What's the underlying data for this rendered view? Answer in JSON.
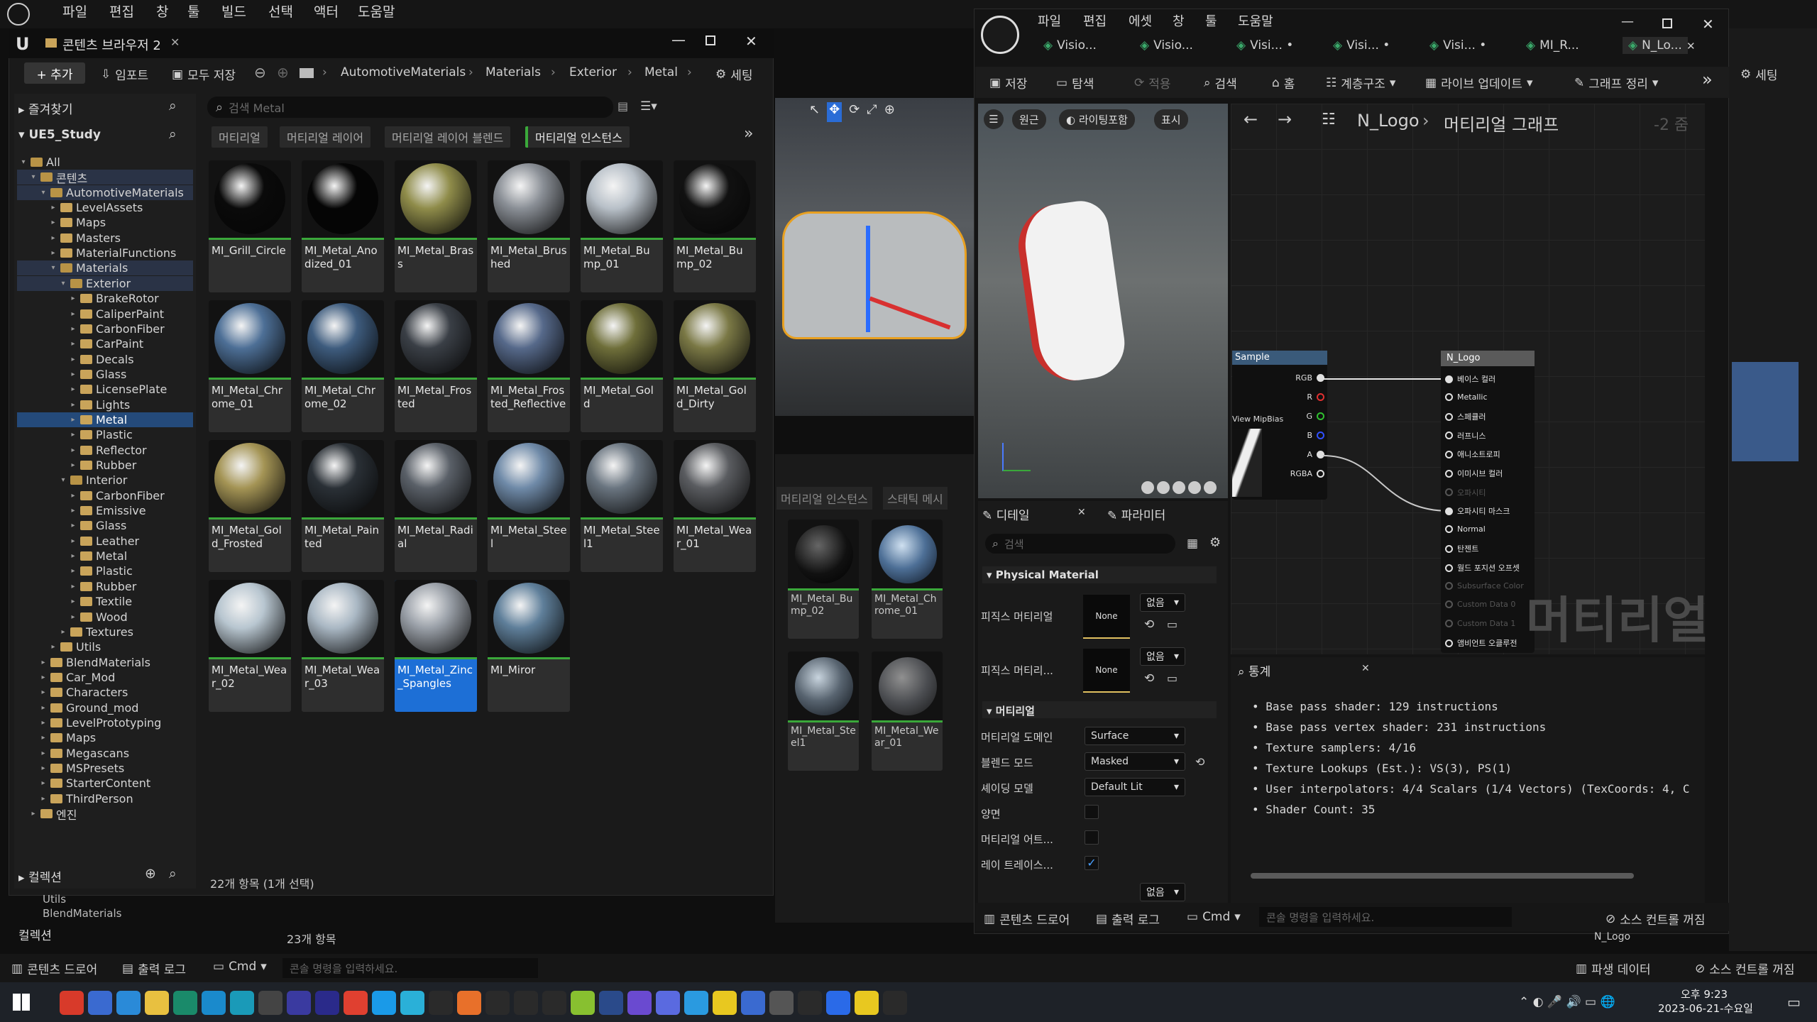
{
  "main_menu": {
    "items": [
      "파일",
      "편집",
      "창",
      "툴",
      "빌드",
      "선택",
      "액터",
      "도움말"
    ]
  },
  "content_browser": {
    "title": "콘텐츠 브라우저 2",
    "add_label": "+ 추가",
    "import_label": "임포트",
    "save_all_label": "모두 저장",
    "breadcrumb": [
      "AutomotiveMaterials",
      "Materials",
      "Exterior",
      "Metal"
    ],
    "settings_label": "세팅",
    "favorites_label": "즐겨찾기",
    "project_label": "UE5_Study",
    "search_placeholder": "검색 Metal",
    "filters": [
      "머티리얼",
      "머티리얼 레이어",
      "머티리얼 레이어 블렌드",
      "머티리얼 인스턴스"
    ],
    "tree": [
      {
        "label": "All",
        "indent": 0,
        "open": true
      },
      {
        "label": "콘텐츠",
        "indent": 1,
        "open": true
      },
      {
        "label": "AutomotiveMaterials",
        "indent": 2,
        "open": true
      },
      {
        "label": "LevelAssets",
        "indent": 3
      },
      {
        "label": "Maps",
        "indent": 3
      },
      {
        "label": "Masters",
        "indent": 3
      },
      {
        "label": "MaterialFunctions",
        "indent": 3
      },
      {
        "label": "Materials",
        "indent": 3,
        "open": true
      },
      {
        "label": "Exterior",
        "indent": 4,
        "open": true
      },
      {
        "label": "BrakeRotor",
        "indent": 5
      },
      {
        "label": "CaliperPaint",
        "indent": 5
      },
      {
        "label": "CarbonFiber",
        "indent": 5
      },
      {
        "label": "CarPaint",
        "indent": 5
      },
      {
        "label": "Decals",
        "indent": 5
      },
      {
        "label": "Glass",
        "indent": 5
      },
      {
        "label": "LicensePlate",
        "indent": 5
      },
      {
        "label": "Lights",
        "indent": 5
      },
      {
        "label": "Metal",
        "indent": 5,
        "selected": true
      },
      {
        "label": "Plastic",
        "indent": 5
      },
      {
        "label": "Reflector",
        "indent": 5
      },
      {
        "label": "Rubber",
        "indent": 5
      },
      {
        "label": "Interior",
        "indent": 4,
        "open": true
      },
      {
        "label": "CarbonFiber",
        "indent": 5
      },
      {
        "label": "Emissive",
        "indent": 5
      },
      {
        "label": "Glass",
        "indent": 5
      },
      {
        "label": "Leather",
        "indent": 5
      },
      {
        "label": "Metal",
        "indent": 5
      },
      {
        "label": "Plastic",
        "indent": 5
      },
      {
        "label": "Rubber",
        "indent": 5
      },
      {
        "label": "Textile",
        "indent": 5
      },
      {
        "label": "Wood",
        "indent": 5
      },
      {
        "label": "Textures",
        "indent": 4
      },
      {
        "label": "Utils",
        "indent": 3
      },
      {
        "label": "BlendMaterials",
        "indent": 2
      },
      {
        "label": "Car_Mod",
        "indent": 2
      },
      {
        "label": "Characters",
        "indent": 2
      },
      {
        "label": "Ground_mod",
        "indent": 2
      },
      {
        "label": "LevelPrototyping",
        "indent": 2
      },
      {
        "label": "Maps",
        "indent": 2
      },
      {
        "label": "Megascans",
        "indent": 2
      },
      {
        "label": "MSPresets",
        "indent": 2
      },
      {
        "label": "StarterContent",
        "indent": 2
      },
      {
        "label": "ThirdPerson",
        "indent": 2
      },
      {
        "label": "엔진",
        "indent": 1
      }
    ],
    "collections_label": "컬렉션",
    "assets": [
      {
        "name": "MI_Grill_Circle",
        "color": "#0a0a0a"
      },
      {
        "name": "MI_Metal_Anodized_01",
        "color": "#050505"
      },
      {
        "name": "MI_Metal_Brass",
        "color": "#8f8c4a"
      },
      {
        "name": "MI_Metal_Brushed",
        "color": "#8a8f96"
      },
      {
        "name": "MI_Metal_Bump_01",
        "color": "#b8c0c8"
      },
      {
        "name": "MI_Metal_Bump_02",
        "color": "#111111"
      },
      {
        "name": "MI_Metal_Chrome_01",
        "color": "#4d6f96"
      },
      {
        "name": "MI_Metal_Chrome_02",
        "color": "#3e5c7e"
      },
      {
        "name": "MI_Metal_Frosted",
        "color": "#3a3f46"
      },
      {
        "name": "MI_Metal_Frosted_Reflective",
        "color": "#56698a"
      },
      {
        "name": "MI_Metal_Gold",
        "color": "#6f6f3a"
      },
      {
        "name": "MI_Metal_Gold_Dirty",
        "color": "#7a7845"
      },
      {
        "name": "MI_Metal_Gold_Frosted",
        "color": "#a49455"
      },
      {
        "name": "MI_Metal_Painted",
        "color": "#2a3036"
      },
      {
        "name": "MI_Metal_Radial",
        "color": "#5a6068"
      },
      {
        "name": "MI_Metal_Steel",
        "color": "#6f8aa8"
      },
      {
        "name": "MI_Metal_Steel1",
        "color": "#6a7580"
      },
      {
        "name": "MI_Metal_Wear_01",
        "color": "#5a5c60"
      },
      {
        "name": "MI_Metal_Wear_02",
        "color": "#b8c6d0"
      },
      {
        "name": "MI_Metal_Wear_03",
        "color": "#aab8c4"
      },
      {
        "name": "MI_Metal_Zinc_Spangles",
        "color": "#9aa0a8",
        "selected": true
      },
      {
        "name": "MI_Miror",
        "color": "#5f7f9a"
      }
    ],
    "item_count": "22개 항목 (1개 선택)"
  },
  "bottom_bar": {
    "content_drawer": "콘텐츠 드로어",
    "output_log": "출력 로그",
    "cmd": "Cmd",
    "console_placeholder": "콘솔 명령을 입력하세요.",
    "derived_data": "파생 데이터",
    "source_control": "소스 컨트롤 꺼짐",
    "item_count_behind": "23개 항목"
  },
  "viewport_behind": {
    "filter_tabs": [
      "머티리얼 인스턴스",
      "스태틱 메시"
    ],
    "assets": [
      "MI_Metal_Bump_02",
      "MI_Metal_Chrome_01",
      "MI_Metal_Steel1",
      "MI_Metal_Wear_01"
    ]
  },
  "material_editor": {
    "menu": [
      "파일",
      "편집",
      "에셋",
      "창",
      "툴",
      "도움말"
    ],
    "tabs": [
      "Visio...",
      "Visio...",
      "Visi... •",
      "Visi... •",
      "Visi... •",
      "MI_R...",
      "N_Lo..."
    ],
    "toolbar": {
      "save": "저장",
      "browse": "탐색",
      "apply": "적용",
      "search": "검색",
      "home": "홈",
      "hierarchy": "계층구조",
      "live_update": "라이브 업데이트",
      "clean_graph": "그래프 정리"
    },
    "viewport_buttons": [
      "원근",
      "라이팅포함",
      "표시"
    ],
    "graph_breadcrumb": [
      "N_Logo",
      "머티리얼 그래프"
    ],
    "zoom": "-2 줌",
    "sample_node": {
      "title": "Sample",
      "pins": [
        "RGB",
        "R",
        "G",
        "B",
        "A",
        "RGBA"
      ],
      "extra": "View MipBias"
    },
    "result_node": {
      "title": "N_Logo",
      "pins": [
        "베이스 컬러",
        "Metallic",
        "스페큘러",
        "러프니스",
        "애니소트로피",
        "이미시브 컬러",
        "오파시티",
        "오파시티 마스크",
        "Normal",
        "탄젠트",
        "월드 포지션 오프셋",
        "Subsurface Color",
        "Custom Data 0",
        "Custom Data 1",
        "앰비언트 오클루전"
      ]
    },
    "watermark": "머티리얼",
    "details_tab": "디테일",
    "params_tab": "파라미터",
    "details_search_placeholder": "검색",
    "physical_section": "Physical Material",
    "phys_mat_label": "피직스 머티리얼",
    "phys_mat_label2": "피직스 머티리...",
    "none_label": "None",
    "none_dd": "없음",
    "material_section": "머티리얼",
    "props": [
      {
        "label": "머티리얼 도메인",
        "value": "Surface"
      },
      {
        "label": "블렌드 모드",
        "value": "Masked"
      },
      {
        "label": "셰이딩 모델",
        "value": "Default Lit"
      }
    ],
    "checks": [
      {
        "label": "양면",
        "checked": false
      },
      {
        "label": "머티리얼 어트...",
        "checked": false
      },
      {
        "label": "레이 트레이스...",
        "checked": true
      }
    ],
    "stats_title": "통계",
    "stats": [
      "Base pass shader: 129 instructions",
      "Base pass vertex shader: 231 instructions",
      "Texture samplers: 4/16",
      "Texture Lookups (Est.): VS(3), PS(1)",
      "User interpolators: 4/4 Scalars (1/4 Vectors) (TexCoords: 4, C",
      "Shader Count: 35"
    ],
    "bottom": {
      "content_drawer": "콘텐츠 드로어",
      "output_log": "출력 로그",
      "cmd": "Cmd",
      "console_placeholder": "콘솔 명령을 입력하세요.",
      "source_control": "소스 컨트롤 꺼짐"
    }
  },
  "right_panel_behind": {
    "settings": "세팅",
    "n_logo": "N_Logo"
  },
  "taskbar": {
    "time": "오후 9:23",
    "date": "2023-06-21-수요일"
  }
}
